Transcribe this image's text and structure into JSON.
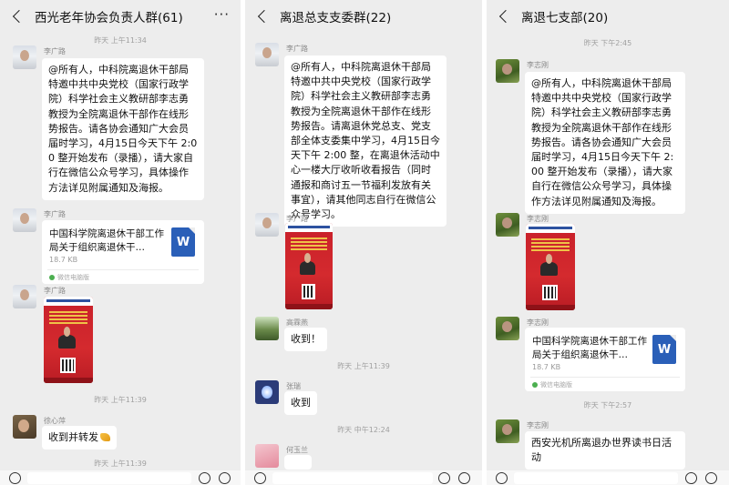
{
  "panels": [
    {
      "title": "西光老年协会负责人群(61)",
      "timestamps": [
        "昨天 上午11:34",
        "昨天 上午11:39",
        "昨天 上午11:39"
      ],
      "msg1": {
        "sender": "李广路",
        "text": "@所有人，中科院离退休干部局特邀中共中央党校（国家行政学院）科学社会主义教研部李志勇教授为全院离退休干部作在线形势报告。请各协会通知广大会员届时学习，4月15日今天下午 2:00 整开始发布（录播），请大家自行在微信公众号学习，具体操作方法详见附属通知及海报。"
      },
      "msg2": {
        "sender": "李广路",
        "file_name": "中国科学院离退休干部工作局关于组织离退休干…",
        "file_size": "18.7 KB",
        "file_source": "微信电脑版",
        "file_icon": "W"
      },
      "msg3": {
        "sender": "李广路"
      },
      "msg4": {
        "sender": "徐心萍",
        "text": "收到并转发"
      }
    },
    {
      "title": "离退总支支委群(22)",
      "timestamps": [
        "昨天 上午11:39",
        "昨天 中午12:24"
      ],
      "msg1": {
        "sender": "李广路",
        "text": "@所有人，中科院离退休干部局特邀中共中央党校（国家行政学院）科学社会主义教研部李志勇教授为全院离退休干部作在线形势报告。请离退休党总支、党支部全体支委集中学习，4月15日今天下午 2:00 整，在离退休活动中心一楼大厅收听收看报告（同时通报和商讨五一节福利发放有关事宜），请其他同志自行在微信公众号学习。"
      },
      "msg2": {
        "sender": "李广路"
      },
      "msg3": {
        "sender": "高霖燕",
        "text": "收到！"
      },
      "msg4": {
        "sender": "张瑞",
        "text": "收到"
      },
      "msg5": {
        "sender": "何玉兰"
      }
    },
    {
      "title": "离退七支部(20)",
      "timestamps": [
        "昨天 下午2:45",
        "昨天 下午2:57"
      ],
      "msg1": {
        "sender": "李志刚",
        "text": "@所有人，中科院离退休干部局特邀中共中央党校（国家行政学院）科学社会主义教研部李志勇教授为全院离退休干部作在线形势报告。请各协会通知广大会员届时学习，4月15日今天下午 2:00 整开始发布（录播），请大家自行在微信公众号学习，具体操作方法详见附属通知及海报。"
      },
      "msg2": {
        "sender": "李志刚"
      },
      "msg3": {
        "sender": "李志刚",
        "file_name": "中国科学院离退休干部工作局关于组织离退休干…",
        "file_size": "18.7 KB",
        "file_source": "微信电脑版",
        "file_icon": "W"
      },
      "msg4": {
        "sender": "李志刚",
        "text": "西安光机所离退办世界读书日活动"
      }
    }
  ],
  "icons": {
    "back": "chevron-left-icon",
    "more": "more-dots-icon",
    "voice": "voice-icon",
    "emoji": "emoji-icon",
    "plus": "plus-icon"
  },
  "colors": {
    "panel_bg": "#ededed",
    "bubble_bg": "#ffffff",
    "word_blue": "#2a5fb8",
    "poster_red": "#c8202a"
  }
}
